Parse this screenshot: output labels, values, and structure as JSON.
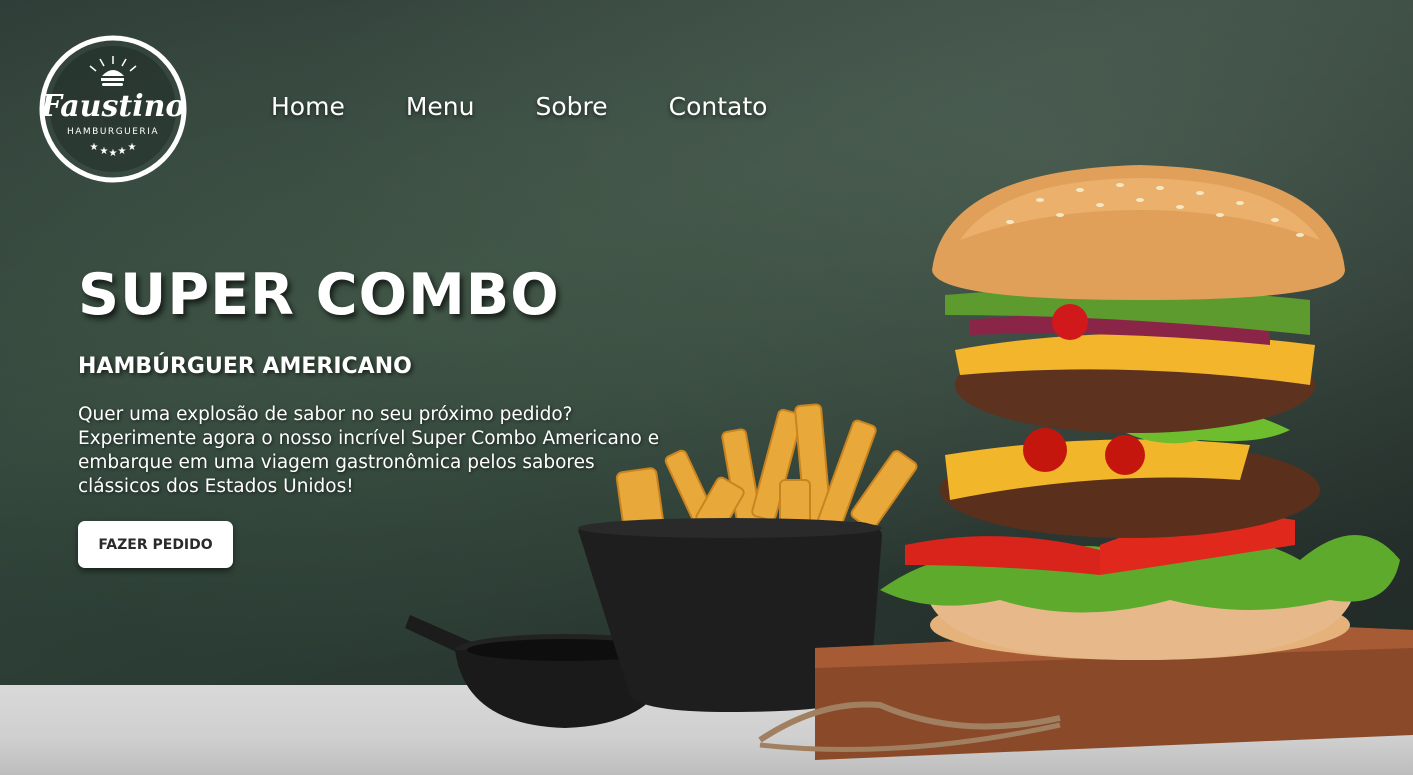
{
  "brand": {
    "name": "Faustino",
    "tagline": "HAMBURGUERIA"
  },
  "nav": {
    "items": [
      {
        "label": "Home"
      },
      {
        "label": "Menu"
      },
      {
        "label": "Sobre"
      },
      {
        "label": "Contato"
      }
    ]
  },
  "hero": {
    "title": "SUPER COMBO",
    "subtitle": "HAMBÚRGUER AMERICANO",
    "description_lines": [
      "Quer uma explosão de sabor no seu próximo pedido?",
      "Experimente agora o nosso incrível Super Combo Americano e",
      "embarque em uma viagem gastronômica pelos sabores",
      "clássicos dos Estados Unidos!"
    ],
    "cta_label": "FAZER PEDIDO"
  },
  "colors": {
    "text": "#ffffff",
    "button_bg": "#ffffff",
    "button_text": "#2a2a2a"
  }
}
